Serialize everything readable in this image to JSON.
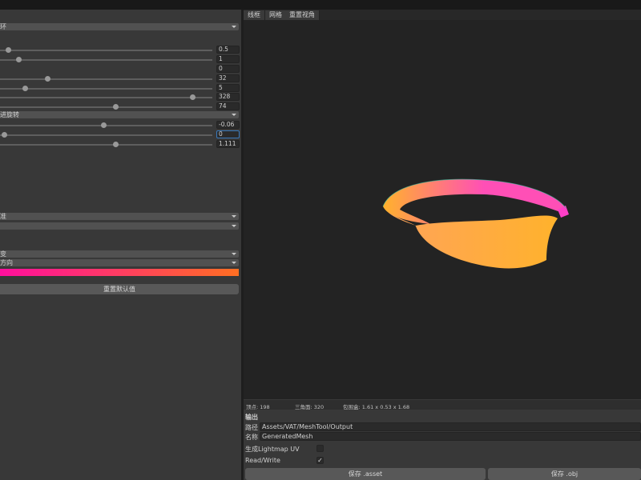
{
  "left_panel": {
    "dropdowns": [
      {
        "label": "环"
      },
      {
        "label": "进旋转"
      },
      {
        "label": "准"
      },
      {
        "label": ""
      },
      {
        "label": "变"
      },
      {
        "label": "方向"
      }
    ],
    "sliders": [
      {
        "value": "0.5",
        "fraction": 0.02
      },
      {
        "value": "1",
        "fraction": 0.07
      },
      {
        "value": "0",
        "fraction": 0.0
      },
      {
        "value": "32",
        "fraction": 0.21
      },
      {
        "value": "5",
        "fraction": 0.1
      },
      {
        "value": "328",
        "fraction": 0.91
      },
      {
        "value": "74",
        "fraction": 0.54
      },
      {
        "value": "-0.06",
        "fraction": 0.48
      },
      {
        "value": "0",
        "fraction": 0.0
      },
      {
        "value": "1.111",
        "fraction": 0.54
      }
    ],
    "gradient_colors": [
      "#ff0f9d",
      "#ff6f22"
    ],
    "reset_label": "重置默认值"
  },
  "viewport": {
    "tabs": [
      "线框",
      "网格",
      "重置视角"
    ],
    "mesh_colors": {
      "pink": "#ff4fb6",
      "orange": "#ffb22c",
      "edge": "#3fbfa0"
    }
  },
  "stats": {
    "vertices": "顶点: 198",
    "triangles": "三角面: 320",
    "bounds": "包围盒: 1.61 x 0.53 x 1.68"
  },
  "output": {
    "title": "输出",
    "path_label": "路径",
    "path_value": "Assets/VAT/MeshTool/Output",
    "name_label": "名称",
    "name_value": "GeneratedMesh",
    "lightmap_label": "生成Lightmap UV",
    "lightmap_checked": false,
    "readwrite_label": "Read/Write",
    "readwrite_checked": true,
    "check_glyph": "✓",
    "save_asset_label": "保存 .asset",
    "save_obj_label": "保存 .obj"
  }
}
